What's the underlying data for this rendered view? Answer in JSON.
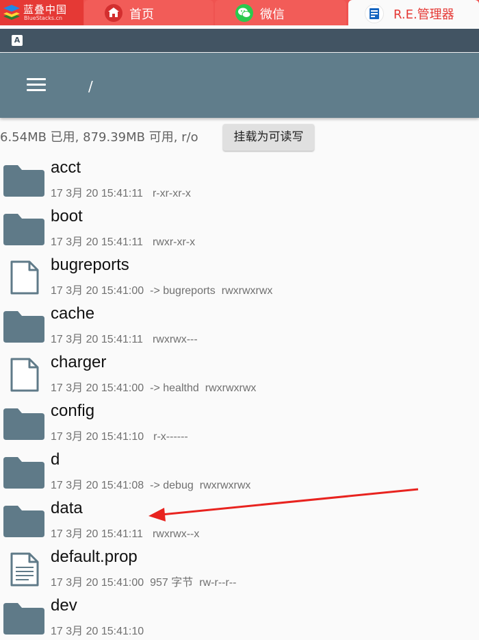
{
  "app": {
    "logo_name": "蓝叠中国",
    "logo_sub": "BlueStacks.cn"
  },
  "tabs": [
    {
      "label": "首页",
      "icon": "home-icon"
    },
    {
      "label": "微信",
      "icon": "wechat-icon"
    },
    {
      "label": "R.E.管理器",
      "icon": "re-manager-icon"
    }
  ],
  "status_bar": {
    "icon": "a-notification-icon",
    "icon_text": "A"
  },
  "toolbar": {
    "path": "/",
    "menu_icon": "hamburger-menu-icon"
  },
  "storage_info": "6.54MB 已用, 879.39MB 可用, r/o",
  "mount_button": "挂载为可读写",
  "files": [
    {
      "name": "acct",
      "type": "folder",
      "date": "17 3月 20 15:41:11",
      "extra": "",
      "perm": "r-xr-xr-x"
    },
    {
      "name": "boot",
      "type": "folder",
      "date": "17 3月 20 15:41:11",
      "extra": "",
      "perm": "rwxr-xr-x"
    },
    {
      "name": "bugreports",
      "type": "file",
      "date": "17 3月 20 15:41:00",
      "extra": "-> bugreports",
      "perm": "rwxrwxrwx"
    },
    {
      "name": "cache",
      "type": "folder",
      "date": "17 3月 20 15:41:11",
      "extra": "",
      "perm": "rwxrwx---"
    },
    {
      "name": "charger",
      "type": "file",
      "date": "17 3月 20 15:41:00",
      "extra": "-> healthd",
      "perm": "rwxrwxrwx"
    },
    {
      "name": "config",
      "type": "folder",
      "date": "17 3月 20 15:41:10",
      "extra": "",
      "perm": "r-x------"
    },
    {
      "name": "d",
      "type": "folder",
      "date": "17 3月 20 15:41:08",
      "extra": "-> debug",
      "perm": "rwxrwxrwx"
    },
    {
      "name": "data",
      "type": "folder",
      "date": "17 3月 20 15:41:11",
      "extra": "",
      "perm": "rwxrwx--x"
    },
    {
      "name": "default.prop",
      "type": "text",
      "date": "17 3月 20 15:41:00",
      "extra": "957 字节",
      "perm": "rw-r--r--"
    },
    {
      "name": "dev",
      "type": "folder",
      "date": "17 3月 20 15:41:10",
      "extra": "",
      "perm": ""
    }
  ],
  "colors": {
    "tab_bar": "#ef5350",
    "status_bar": "#425463",
    "toolbar": "#607d8b",
    "folder_icon": "#5f7a88",
    "arrow": "#e8231f"
  }
}
